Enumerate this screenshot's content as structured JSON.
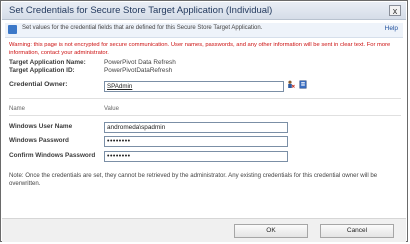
{
  "dialog": {
    "title": "Set Credentials for Secure Store Target Application (Individual)",
    "close_label": "x"
  },
  "info": {
    "text": "Set values for the credential fields that are defined for this Secure Store Target Application.",
    "help_label": "Help"
  },
  "warning": "Warning: this page is not encrypted for secure communication. User names, passwords, and any other information will be sent in clear text. For more information, contact your administrator.",
  "target": {
    "name_label": "Target Application Name:",
    "name_value": "PowerPivot Data Refresh",
    "id_label": "Target Application ID:",
    "id_value": "PowerPivotDataRefresh"
  },
  "owner": {
    "label": "Credential Owner:",
    "value": "SPAdmin",
    "check_icon": "check-names-icon",
    "browse_icon": "address-book-icon"
  },
  "columns": {
    "name": "Name",
    "value": "Value"
  },
  "fields": {
    "user_label": "Windows User Name",
    "user_value": "andromeda\\spadmin",
    "password_label": "Windows Password",
    "password_value": "••••••••",
    "confirm_label": "Confirm Windows Password",
    "confirm_value": "••••••••"
  },
  "note": "Note: Once the credentials are set, they cannot be retrieved by the administrator. Any existing credentials for this credential owner will be overwritten.",
  "buttons": {
    "ok": "OK",
    "cancel": "Cancel"
  }
}
